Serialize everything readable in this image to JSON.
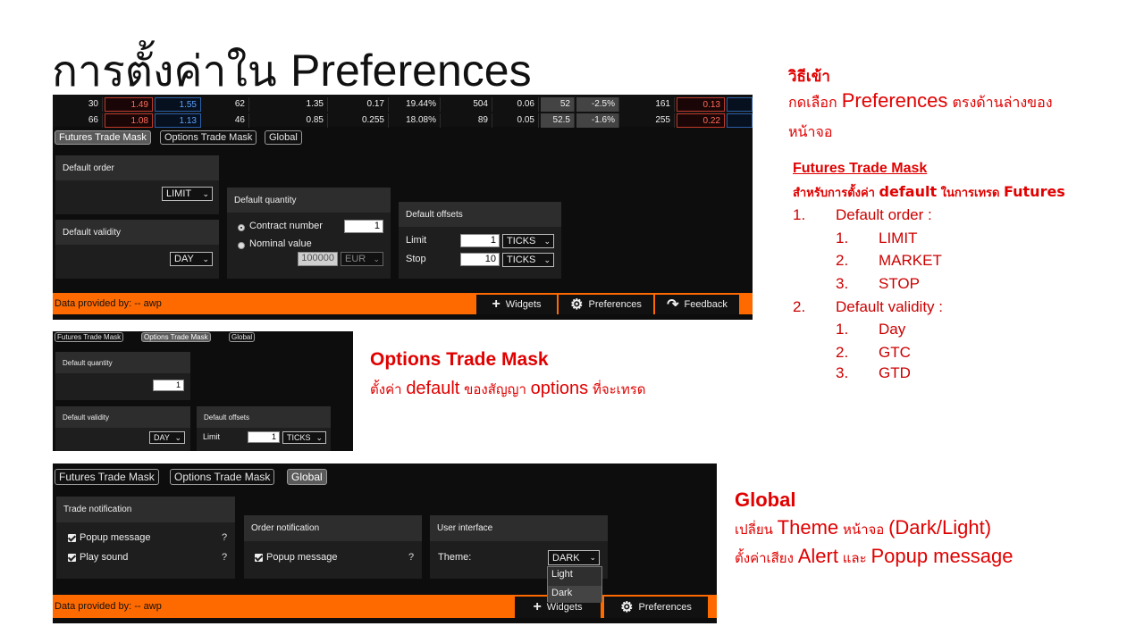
{
  "title": {
    "thai": "การตั้งค่าใน",
    "en": "Preferences"
  },
  "grid_rows": [
    [
      "30",
      "1.49",
      "1.55",
      "62",
      "1.35",
      "0.17",
      "19.44%",
      "504",
      "0.06",
      "52",
      "-2.5%",
      "161",
      "0.13"
    ],
    [
      "66",
      "1.08",
      "1.13",
      "46",
      "0.85",
      "0.255",
      "18.08%",
      "89",
      "0.05",
      "52.5",
      "-1.6%",
      "255",
      "0.22"
    ]
  ],
  "tabs": {
    "futures": "Futures Trade Mask",
    "options": "Options Trade Mask",
    "global": "Global"
  },
  "futures_panel": {
    "default_order": "Default order",
    "default_order_value": "LIMIT",
    "default_validity": "Default validity",
    "default_validity_value": "DAY",
    "default_quantity": "Default quantity",
    "contract_number": "Contract number",
    "contract_value": "1",
    "nominal_value": "Nominal value",
    "nominal_amount": "100000",
    "currency": "EUR",
    "default_offsets": "Default offsets",
    "limit": "Limit",
    "limit_value": "1",
    "stop": "Stop",
    "stop_value": "10",
    "ticks": "TICKS"
  },
  "options_panel": {
    "default_quantity": "Default quantity",
    "quantity_value": "1",
    "default_validity": "Default validity",
    "validity_value": "DAY",
    "default_offsets": "Default offsets",
    "limit": "Limit",
    "limit_value": "1",
    "ticks": "TICKS"
  },
  "global_panel": {
    "trade_notification": "Trade notification",
    "popup_message": "Popup message",
    "play_sound": "Play sound",
    "order_notification": "Order notification",
    "user_interface": "User interface",
    "theme": "Theme:",
    "theme_value": "DARK",
    "theme_options": [
      "Light",
      "Dark"
    ],
    "q": "?"
  },
  "toolbar": {
    "data_provided": "Data provided by: -- awp",
    "widgets": "Widgets",
    "preferences": "Preferences",
    "feedback": "Feedback"
  },
  "notes": {
    "access_heading": "วิธีเข้า",
    "access_pre": "กดเลือก",
    "access_pref": "Preferences",
    "access_post": "ตรงด้านล่างของ",
    "access_line2": "หน้าจอ",
    "futures_heading": "Futures Trade Mask",
    "futures_sub_pre": "สำหรับการตั้งค่า",
    "futures_sub_default": "default",
    "futures_sub_mid": "ในการเทรด",
    "futures_sub_futures": "Futures",
    "list": [
      {
        "n": "1.",
        "label": "Default order :",
        "items": [
          "LIMIT",
          "MARKET",
          "STOP"
        ]
      },
      {
        "n": "2.",
        "label": "Default validity :",
        "items": [
          "Day",
          "GTC",
          "GTD"
        ]
      }
    ],
    "sub_nums": [
      "1.",
      "2.",
      "3."
    ],
    "options_heading": "Options Trade Mask",
    "options_pre": "ตั้งค่า",
    "options_default": "default",
    "options_mid": "ของสัญญา",
    "options_word": "options",
    "options_post": "ที่จะเทรด",
    "global_heading": "Global",
    "global_l1_pre": "เปลี่ยน",
    "global_l1_theme": "Theme",
    "global_l1_mid": "หน้าจอ",
    "global_l1_post": "(Dark/Light)",
    "global_l2_pre": "ตั้งค่าเสียง",
    "global_l2_alert": "Alert",
    "global_l2_mid": "และ",
    "global_l2_popup": "Popup message"
  },
  "colors": {
    "accent": "#ff6a00",
    "note_red": "#e00000",
    "panel_bg": "#0d0d0d"
  }
}
